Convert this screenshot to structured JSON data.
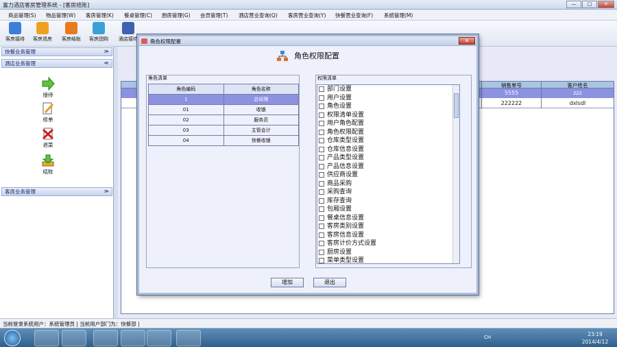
{
  "window": {
    "title": "富力酒店客房管理系统 - [客房结账]",
    "min": "—",
    "max": "□",
    "close": "✕"
  },
  "menu": [
    "商品管理(S)",
    "物品管理(W)",
    "客房管理(K)",
    "餐桌管理(C)",
    "厨房管理(G)",
    "会员管理(T)",
    "酒店营业查询(Q)",
    "客房营业查询(Y)",
    "快餐营业查询(F)",
    "系统管理(M)"
  ],
  "toolbar": [
    {
      "label": "客房接待",
      "icon": "reception-icon",
      "color": "#3c7fd8"
    },
    {
      "label": "客房退房",
      "icon": "checkout-icon",
      "color": "#f0a020"
    },
    {
      "label": "客房结账",
      "icon": "billing-icon",
      "color": "#e87a20"
    },
    {
      "label": "客房团购",
      "icon": "group-buy-icon",
      "color": "#3aa0d8"
    },
    {
      "label": "酒店接待",
      "icon": "hotel-reception-icon",
      "color": "#4060b0"
    }
  ],
  "left": {
    "sections": [
      "快餐业务管理",
      "酒店业务管理",
      "客房业务管理"
    ],
    "items": [
      {
        "label": "接待",
        "icon": "arrow-right-icon"
      },
      {
        "label": "修单",
        "icon": "edit-icon"
      },
      {
        "label": "退菜",
        "icon": "delete-icon"
      },
      {
        "label": "结账",
        "icon": "download-icon"
      }
    ]
  },
  "background_table": {
    "headers": [
      "销售单号",
      "客户姓名"
    ],
    "rows": [
      [
        "5555",
        "zzz"
      ],
      [
        "222222",
        "dxlsdl"
      ]
    ]
  },
  "dialog": {
    "title": "角色权限配置",
    "heading": "角色权限配置",
    "roles_group": "角色清单",
    "roles_headers": [
      "角色编码",
      "角色名称"
    ],
    "roles": [
      [
        "1",
        "总经理"
      ],
      [
        "01",
        "收银"
      ],
      [
        "02",
        "服务员"
      ],
      [
        "03",
        "主管会计"
      ],
      [
        "04",
        "快餐收银"
      ]
    ],
    "perm_group": "权限清单",
    "permissions": [
      "部门设置",
      "用户设置",
      "角色设置",
      "权限清单设置",
      "用户角色配置",
      "角色权限配置",
      "仓库类型设置",
      "仓库信息设置",
      "产品类型设置",
      "产品信息设置",
      "供应商设置",
      "商品采购",
      "采购查询",
      "库存查询",
      "包厢设置",
      "餐桌信息设置",
      "客房类别设置",
      "客房信息设置",
      "客房计价方式设置",
      "厨房设置",
      "菜单类型设置"
    ],
    "add_button": "增加",
    "exit_button": "退出"
  },
  "status": "当前登录系统用户：系统管理员 | 当前用户部门为：快餐部 |",
  "clock": {
    "time": "23:19",
    "date": "2014/4/12",
    "lang": "CH"
  }
}
